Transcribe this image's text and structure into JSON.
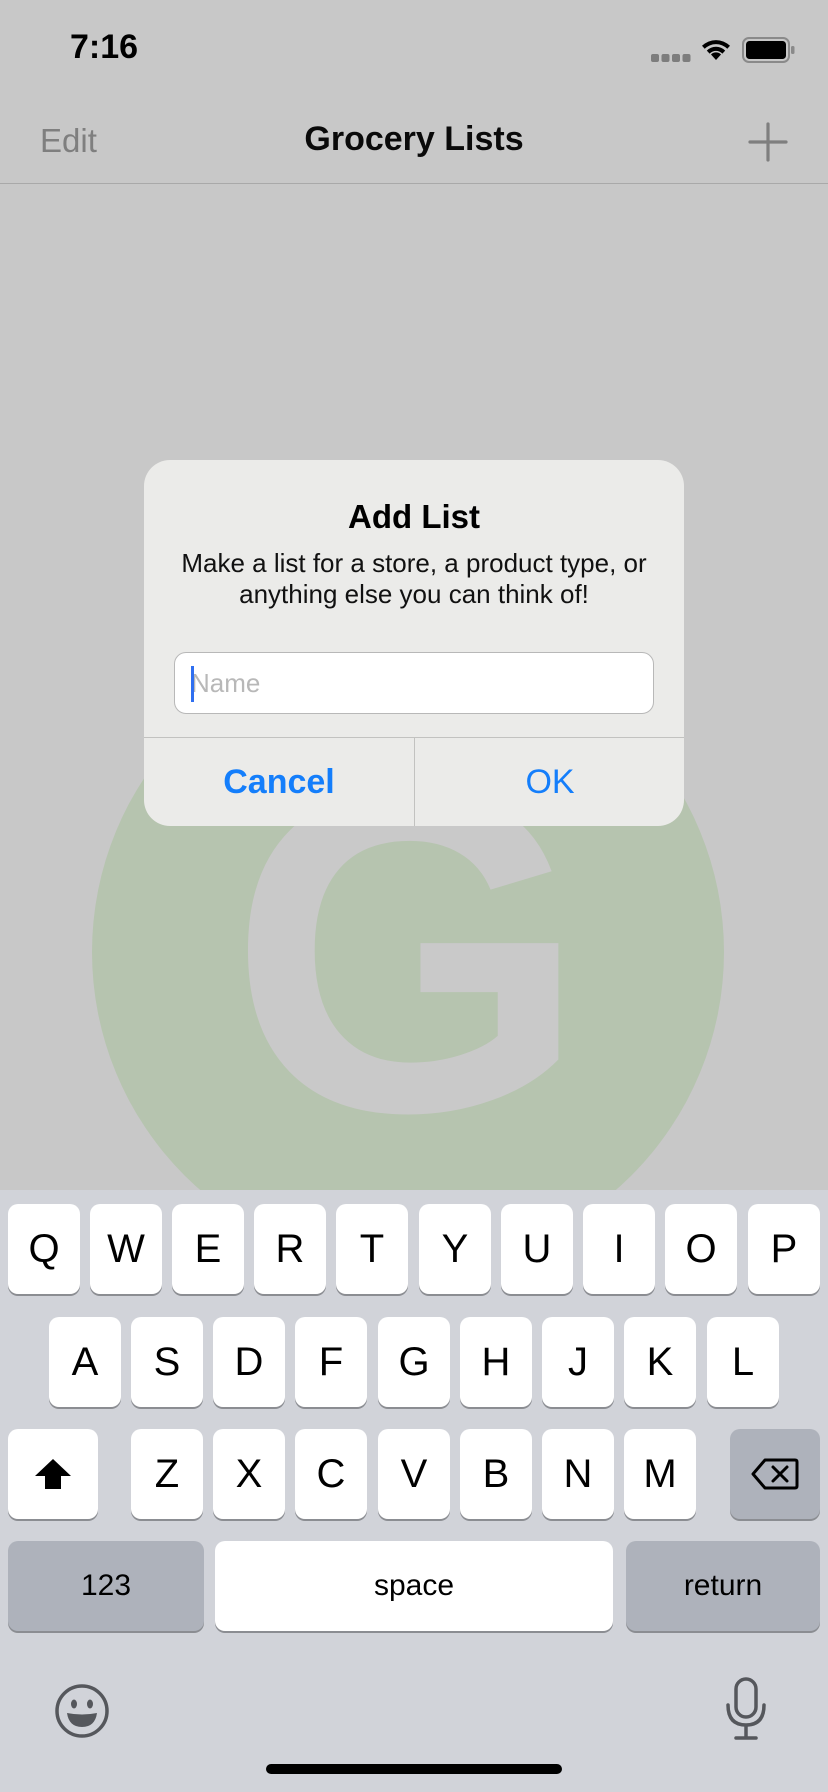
{
  "status_bar": {
    "time": "7:16",
    "signal_icon": "signal-dots-icon",
    "wifi_icon": "wifi-icon",
    "battery_icon": "battery-icon"
  },
  "nav": {
    "edit_label": "Edit",
    "title": "Grocery Lists",
    "add_icon": "plus-icon"
  },
  "background_logo": {
    "letter": "G",
    "circle_color": "#b6c4af"
  },
  "alert": {
    "title": "Add List",
    "message": "Make a list for a store, a product type, or anything else you can think of!",
    "field": {
      "value": "",
      "placeholder": "Name"
    },
    "cancel_label": "Cancel",
    "ok_label": "OK",
    "accent_color": "#147efb"
  },
  "keyboard": {
    "row1": [
      "Q",
      "W",
      "E",
      "R",
      "T",
      "Y",
      "U",
      "I",
      "O",
      "P"
    ],
    "row2": [
      "A",
      "S",
      "D",
      "F",
      "G",
      "H",
      "J",
      "K",
      "L"
    ],
    "row3": [
      "Z",
      "X",
      "C",
      "V",
      "B",
      "N",
      "M"
    ],
    "shift_icon": "shift-arrow-icon",
    "delete_icon": "delete-backward-icon",
    "numbers_label": "123",
    "space_label": "space",
    "return_label": "return",
    "emoji_icon": "emoji-smiley-icon",
    "mic_icon": "microphone-icon"
  }
}
